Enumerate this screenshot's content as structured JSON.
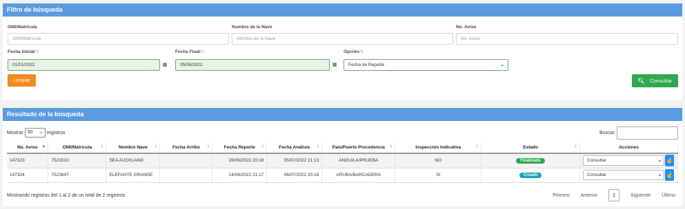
{
  "filter": {
    "header": "Filtro de búsqueda",
    "omi_label": "OMI/Matrícula",
    "omi_placeholder": "OMI/Matrícula",
    "nave_label": "Nombre de la Nave",
    "nave_placeholder": "Nombre de la Nave",
    "aviso_label": "No. Aviso",
    "aviso_placeholder": "No. Aviso",
    "fecha_inicial_label": "Fecha Inicial",
    "fecha_inicial_value": "01/01/2022",
    "fecha_final_label": "Fecha Final",
    "fecha_final_value": "05/08/2022",
    "opcion_label": "Opción",
    "opcion_value": "Fecha de Reporte",
    "required_mark": "(*)",
    "clear_label": "Limpiar",
    "consult_label": "Consultar"
  },
  "results": {
    "header": "Resultado de la búsqueda",
    "show_label": "Mostrar",
    "show_value": "50",
    "records_label": "registros",
    "search_label": "Buscar:",
    "columns": [
      "No. Aviso",
      "OMI/Matrícula",
      "Nombre Nave",
      "Fecha Arribo",
      "Fecha Reporte",
      "Fecha Análisis",
      "País/Puerto Procedencia",
      "Inspección Indicativa",
      "Estado",
      "Acciones"
    ],
    "rows": [
      {
        "aviso": "147323",
        "omi": "7521510",
        "nave": "SEA AUCKLAND",
        "arribo": "",
        "reporte": "28/06/2022 20:18",
        "analisis": "05/07/2022 21:13",
        "pais": "ANGUILA/PRUEBA",
        "inspeccion": "NO",
        "estado": "Finalizado",
        "accion": "Consultar"
      },
      {
        "aviso": "147324",
        "omi": "7523647",
        "nave": "ELEFANTE GRANDE",
        "arribo": "",
        "reporte": "14/06/2022 21:17",
        "analisis": "06/07/2022 20:16",
        "pais": "ARUBA/BARCADERA",
        "inspeccion": "SI",
        "estado": "Creado",
        "accion": "Consultar"
      }
    ],
    "info": "Mostrando registros del 1 al 2 de un total de 2 registros",
    "pager": {
      "first": "Primero",
      "prev": "Anterior",
      "page": "1",
      "next": "Siguiente",
      "last": "Último"
    }
  },
  "colors": {
    "header": "#5b9be0",
    "clear": "#f58a1f",
    "consult": "#2fa84f",
    "finalizado": "#2fa84f",
    "creado": "#17a2b8"
  },
  "icons": {
    "calendar": "calendar-icon",
    "search": "search-icon",
    "hand": "hand-pointer-icon"
  }
}
